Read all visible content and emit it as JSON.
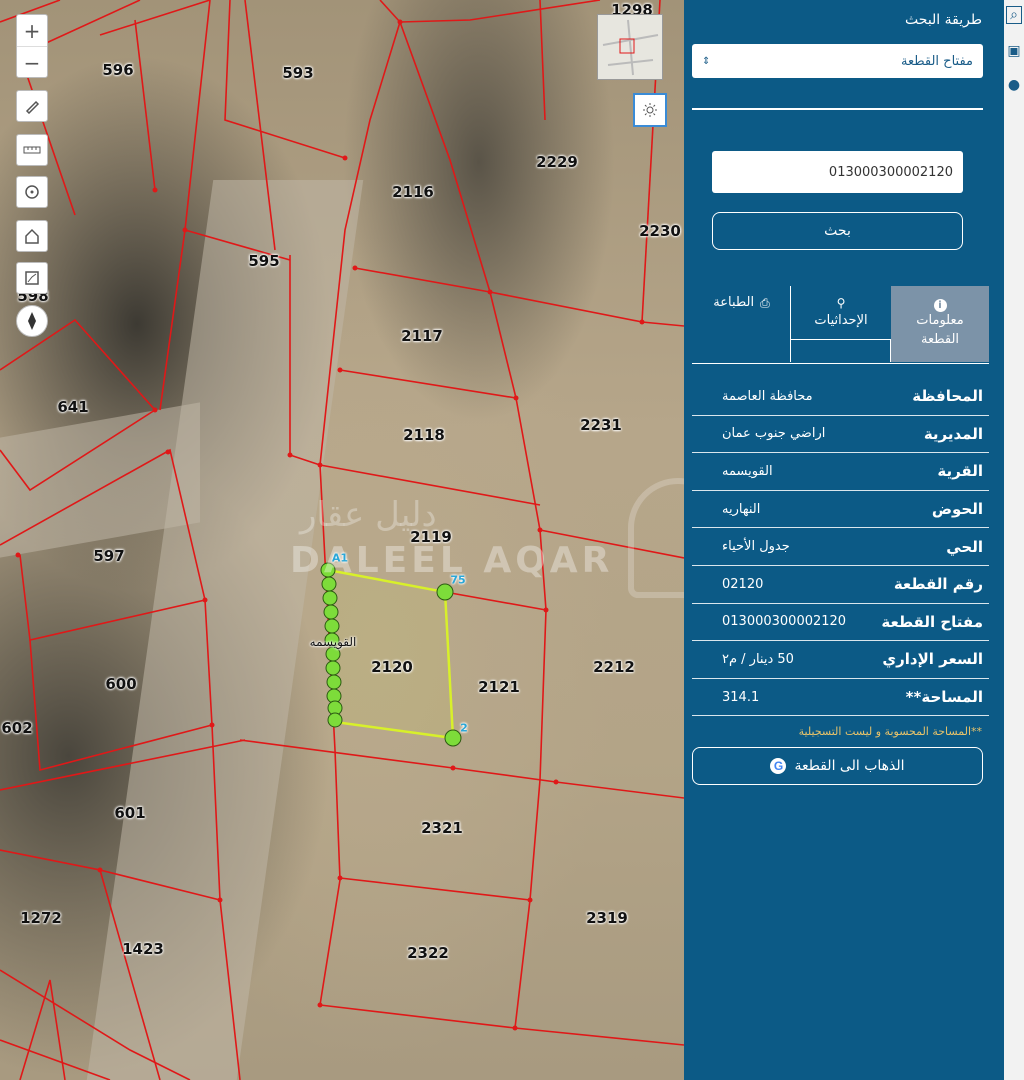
{
  "map": {
    "zoom_in": "+",
    "zoom_out": "−",
    "parcel_labels": [
      {
        "text": "596"
      },
      {
        "text": "593"
      },
      {
        "text": "1298"
      },
      {
        "text": "2116"
      },
      {
        "text": "2229"
      },
      {
        "text": "595"
      },
      {
        "text": "2230"
      },
      {
        "text": "598"
      },
      {
        "text": "2117"
      },
      {
        "text": "641"
      },
      {
        "text": "2118"
      },
      {
        "text": "2231"
      },
      {
        "text": "2119"
      },
      {
        "text": "597"
      },
      {
        "text": "2120"
      },
      {
        "text": "2121"
      },
      {
        "text": "2212"
      },
      {
        "text": "600"
      },
      {
        "text": "602"
      },
      {
        "text": "601"
      },
      {
        "text": "2321"
      },
      {
        "text": "1272"
      },
      {
        "text": "2319"
      },
      {
        "text": "1423"
      },
      {
        "text": "2322"
      }
    ],
    "street_label": "القويسمه",
    "vertex_labels": [
      "A1",
      "75",
      "2"
    ],
    "watermark_latin": "DALEEL AQAR",
    "watermark_arabic": "دليل عقار",
    "colors": {
      "parcel_line": "#e01818",
      "selected_outline": "#d8f02a",
      "vertex": "#7ddc3a"
    }
  },
  "panel": {
    "search_method_title": "طريقة البحث",
    "search_method_value": "مفتاح القطعة",
    "search_input_value": "013000300002120",
    "search_button": "بحث",
    "tabs": [
      {
        "label": "معلومات القطعة",
        "icon": "info-icon",
        "active": true
      },
      {
        "label": "الإحداثيات",
        "icon": "pin-icon",
        "active": false
      },
      {
        "label": "الطباعة",
        "icon": "printer-icon",
        "active": false
      }
    ],
    "info": [
      {
        "key": "المحافظة",
        "value": "محافظة العاصمة"
      },
      {
        "key": "المديرية",
        "value": "اراضي جنوب عمان"
      },
      {
        "key": "القرية",
        "value": "القويسمه"
      },
      {
        "key": "الحوض",
        "value": "النهاريه"
      },
      {
        "key": "الحي",
        "value": "جدول الأحياء"
      },
      {
        "key": "رقم القطعة",
        "value": "02120"
      },
      {
        "key": "مفتاح القطعة",
        "value": "013000300002120"
      },
      {
        "key": "السعر الإداري",
        "value": "50 دينار / م٢"
      },
      {
        "key": "المساحة**",
        "value": "314.1"
      }
    ],
    "note": "**المساحة المحسوبة و ليست التسجيلية",
    "goto_button": "الذهاب الى القطعة",
    "google_letter": "G",
    "colors": {
      "background": "#0c5a86",
      "note": "#e8c36a"
    }
  }
}
